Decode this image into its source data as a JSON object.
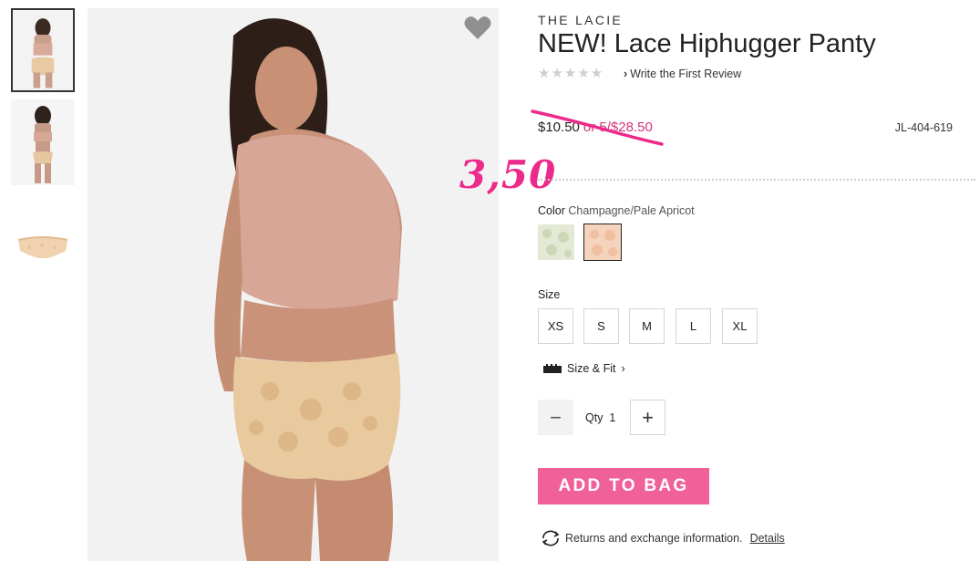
{
  "product": {
    "collection": "THE LACIE",
    "title": "NEW! Lace Hiphugger Panty",
    "stars": "★★★★★",
    "review_link": "Write the First Review",
    "price": "$10.50",
    "deal": "or 5/$28.50",
    "handwritten_price": "3,50",
    "sku": "JL-404-619"
  },
  "color": {
    "label": "Color",
    "selected": "Champagne/Pale Apricot",
    "swatches": [
      "sage-floral",
      "apricot-floral"
    ]
  },
  "size": {
    "label": "Size",
    "options": [
      "XS",
      "S",
      "M",
      "L",
      "XL"
    ],
    "fit_link": "Size & Fit"
  },
  "quantity": {
    "label": "Qty",
    "value": "1",
    "minus": "−",
    "plus": "+"
  },
  "actions": {
    "add_to_bag": "ADD TO BAG"
  },
  "returns": {
    "text": "Returns and exchange information.",
    "details": "Details"
  },
  "colors": {
    "accent_pink": "#f0619a",
    "deal_price": "#d5337c",
    "handwriting": "#ec2a8a"
  }
}
